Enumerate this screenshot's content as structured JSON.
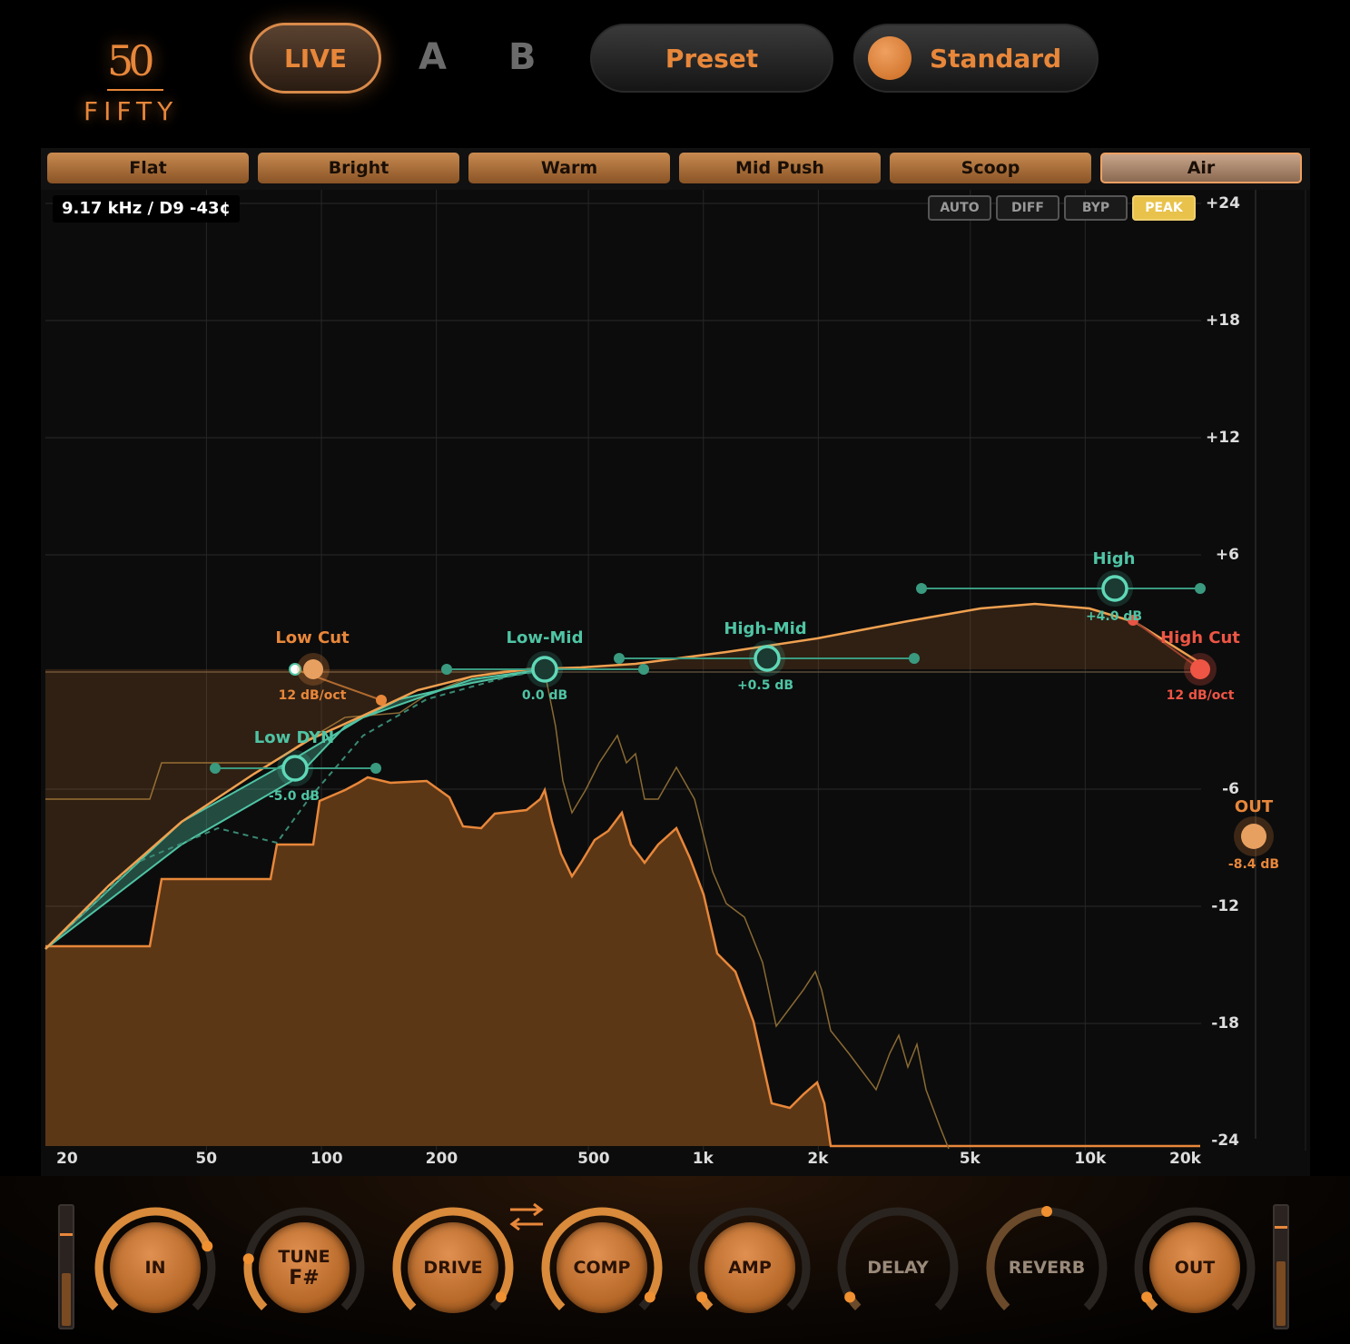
{
  "brand": {
    "number": "50",
    "word": "FIFTY"
  },
  "header": {
    "live_label": "LIVE",
    "a_label": "A",
    "b_label": "B",
    "preset_label": "Preset",
    "mode_label": "Standard"
  },
  "preset_tabs": [
    {
      "label": "Flat",
      "active": false
    },
    {
      "label": "Bright",
      "active": false
    },
    {
      "label": "Warm",
      "active": false
    },
    {
      "label": "Mid Push",
      "active": false
    },
    {
      "label": "Scoop",
      "active": false
    },
    {
      "label": "Air",
      "active": true
    }
  ],
  "readout": "9.17 kHz  /  D9 -43¢",
  "modes": {
    "auto": "AUTO",
    "diff": "DIFF",
    "byp": "BYP",
    "peak": "PEAK",
    "active": "PEAK"
  },
  "y_axis": [
    "+24",
    "+18",
    "+12",
    "+6",
    "0",
    "-6",
    "-12",
    "-18",
    "-24"
  ],
  "x_axis": [
    "20",
    "50",
    "100",
    "200",
    "500",
    "1k",
    "2k",
    "5k",
    "10k",
    "20k"
  ],
  "bands": {
    "low_cut": {
      "name": "Low Cut",
      "value": "12 dB/oct",
      "freq_hz": 100,
      "gain_db": 0
    },
    "low_dyn": {
      "name": "Low DYN",
      "value": "-5.0 dB",
      "freq_hz": 90,
      "gain_db": -5.0
    },
    "low_mid": {
      "name": "Low-Mid",
      "value": "0.0 dB",
      "freq_hz": 400,
      "gain_db": 0.0
    },
    "high_mid": {
      "name": "High-Mid",
      "value": "+0.5 dB",
      "freq_hz": 1500,
      "gain_db": 0.5
    },
    "high": {
      "name": "High",
      "value": "+4.0 dB",
      "freq_hz": 11000,
      "gain_db": 4.0
    },
    "high_cut": {
      "name": "High Cut",
      "value": "12 dB/oct",
      "freq_hz": 20000,
      "gain_db": 0
    }
  },
  "out": {
    "label": "OUT",
    "value": "-8.4 dB",
    "gain_db": -8.4
  },
  "knobs": [
    {
      "label": "IN",
      "sub": "",
      "level": 0.75
    },
    {
      "label": "TUNE",
      "sub": "F#",
      "level": 0.2
    },
    {
      "label": "DRIVE",
      "sub": "",
      "level": 0.95
    },
    {
      "label": "COMP",
      "sub": "",
      "level": 0.95
    },
    {
      "label": "AMP",
      "sub": "",
      "level": 0.05
    },
    {
      "label": "DELAY",
      "sub": "",
      "level": 0.05
    },
    {
      "label": "REVERB",
      "sub": "",
      "level": 0.5
    },
    {
      "label": "OUT",
      "sub": "",
      "level": 0.05
    }
  ],
  "meters": {
    "left_level": 0.45,
    "right_level": 0.55
  },
  "colors": {
    "accent": "#e8873a",
    "teal": "#4fc4a4",
    "red": "#ee5544",
    "peak_on": "#e8c24a"
  }
}
